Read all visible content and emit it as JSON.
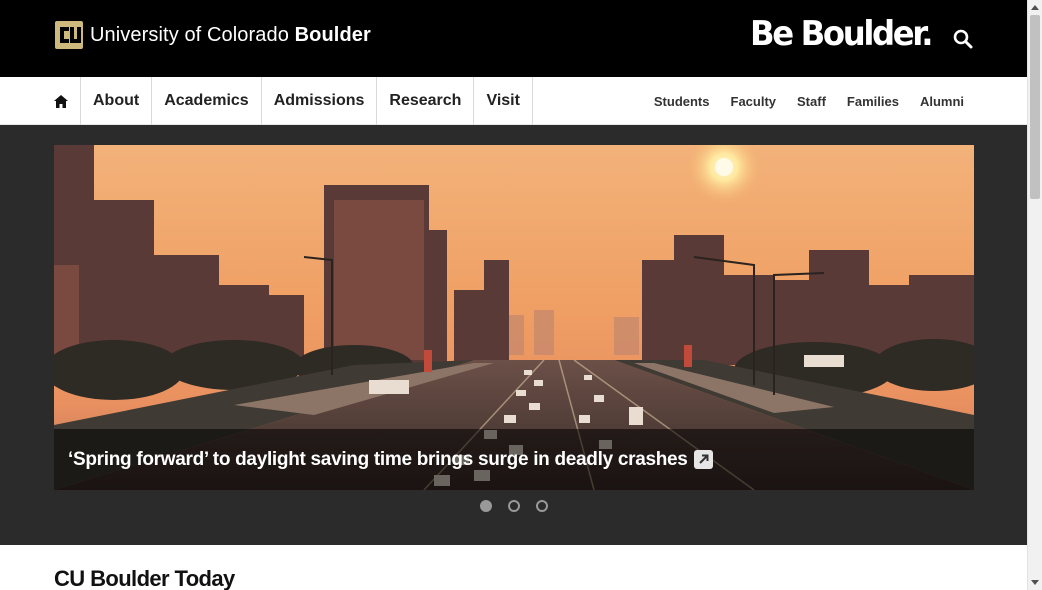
{
  "header": {
    "logo_text_regular": "University of Colorado",
    "logo_text_bold": "Boulder",
    "tagline": "Be Boulder.",
    "search_icon": "search-icon"
  },
  "nav": {
    "home_icon": "home-icon",
    "main_items": [
      {
        "label": "About"
      },
      {
        "label": "Academics"
      },
      {
        "label": "Admissions"
      },
      {
        "label": "Research"
      },
      {
        "label": "Visit"
      }
    ],
    "audience_items": [
      {
        "label": "Students"
      },
      {
        "label": "Faculty"
      },
      {
        "label": "Staff"
      },
      {
        "label": "Families"
      },
      {
        "label": "Alumni"
      }
    ]
  },
  "hero": {
    "caption": "‘Spring forward’ to daylight saving time brings surge in deadly crashes",
    "caption_icon": "external-link-icon",
    "slides_total": 3,
    "active_slide": 1
  },
  "section": {
    "title": "CU Boulder Today"
  },
  "colors": {
    "header_bg": "#000000",
    "hero_band_bg": "#2b2b2b",
    "gold": "#cfb87c"
  }
}
